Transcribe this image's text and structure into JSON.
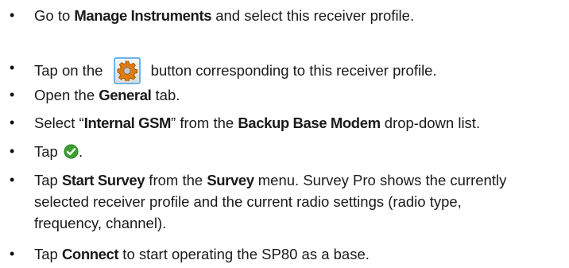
{
  "bullet_char": "•",
  "colors": {
    "text": "#1a1a1a",
    "gear_button_border": "#6db3e6",
    "gear_orange": "#e07b10",
    "check_green": "#3aa12e"
  },
  "icons": {
    "gear": "gear-icon",
    "check": "checkmark-icon"
  },
  "steps": [
    {
      "pre": "Go to ",
      "b1": "Manage Instruments",
      "post": " and select this receiver profile."
    },
    {
      "pre": "Tap on the ",
      "post": " button corresponding to this receiver profile."
    },
    {
      "pre": "Open the ",
      "b1": "General",
      "post": " tab."
    },
    {
      "pre": "Select “",
      "b1": "Internal GSM",
      "mid": "” from the ",
      "b2": "Backup Base Modem",
      "post": " drop-down list."
    },
    {
      "pre": "Tap ",
      "post": "."
    },
    {
      "pre": "Tap ",
      "b1": "Start Survey",
      "mid": " from the ",
      "b2": "Survey",
      "post": " menu. Survey Pro shows the currently selected receiver profile and the current radio settings (radio type, frequency, channel)."
    },
    {
      "pre": "Tap ",
      "b1": "Connect",
      "post": " to start operating the SP80 as a base."
    }
  ]
}
